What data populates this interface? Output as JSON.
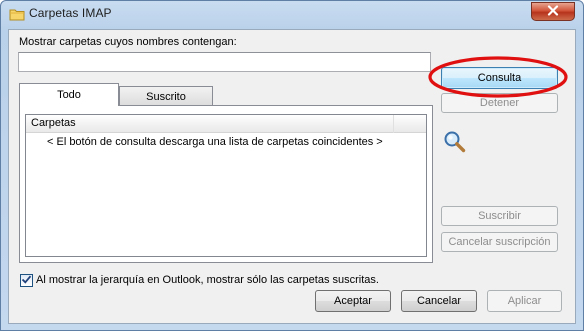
{
  "window": {
    "title": "Carpetas IMAP"
  },
  "search": {
    "label": "Mostrar carpetas cuyos nombres contengan:",
    "value": ""
  },
  "tabs": [
    {
      "label": "Todo"
    },
    {
      "label": "Suscrito"
    }
  ],
  "list": {
    "column_header": "Carpetas",
    "placeholder": "< El botón de consulta descarga una lista de carpetas coincidentes >"
  },
  "side_buttons": {
    "query": "Consulta",
    "stop": "Detener",
    "subscribe": "Suscribir",
    "unsubscribe": "Cancelar suscripción"
  },
  "option": {
    "checked": true,
    "label": "Al mostrar la jerarquía en Outlook, mostrar sólo las carpetas suscritas."
  },
  "footer": {
    "accept": "Aceptar",
    "cancel": "Cancelar",
    "apply": "Aplicar"
  },
  "colors": {
    "highlight_ellipse": "#e01010",
    "accent": "#3c7fb1"
  }
}
